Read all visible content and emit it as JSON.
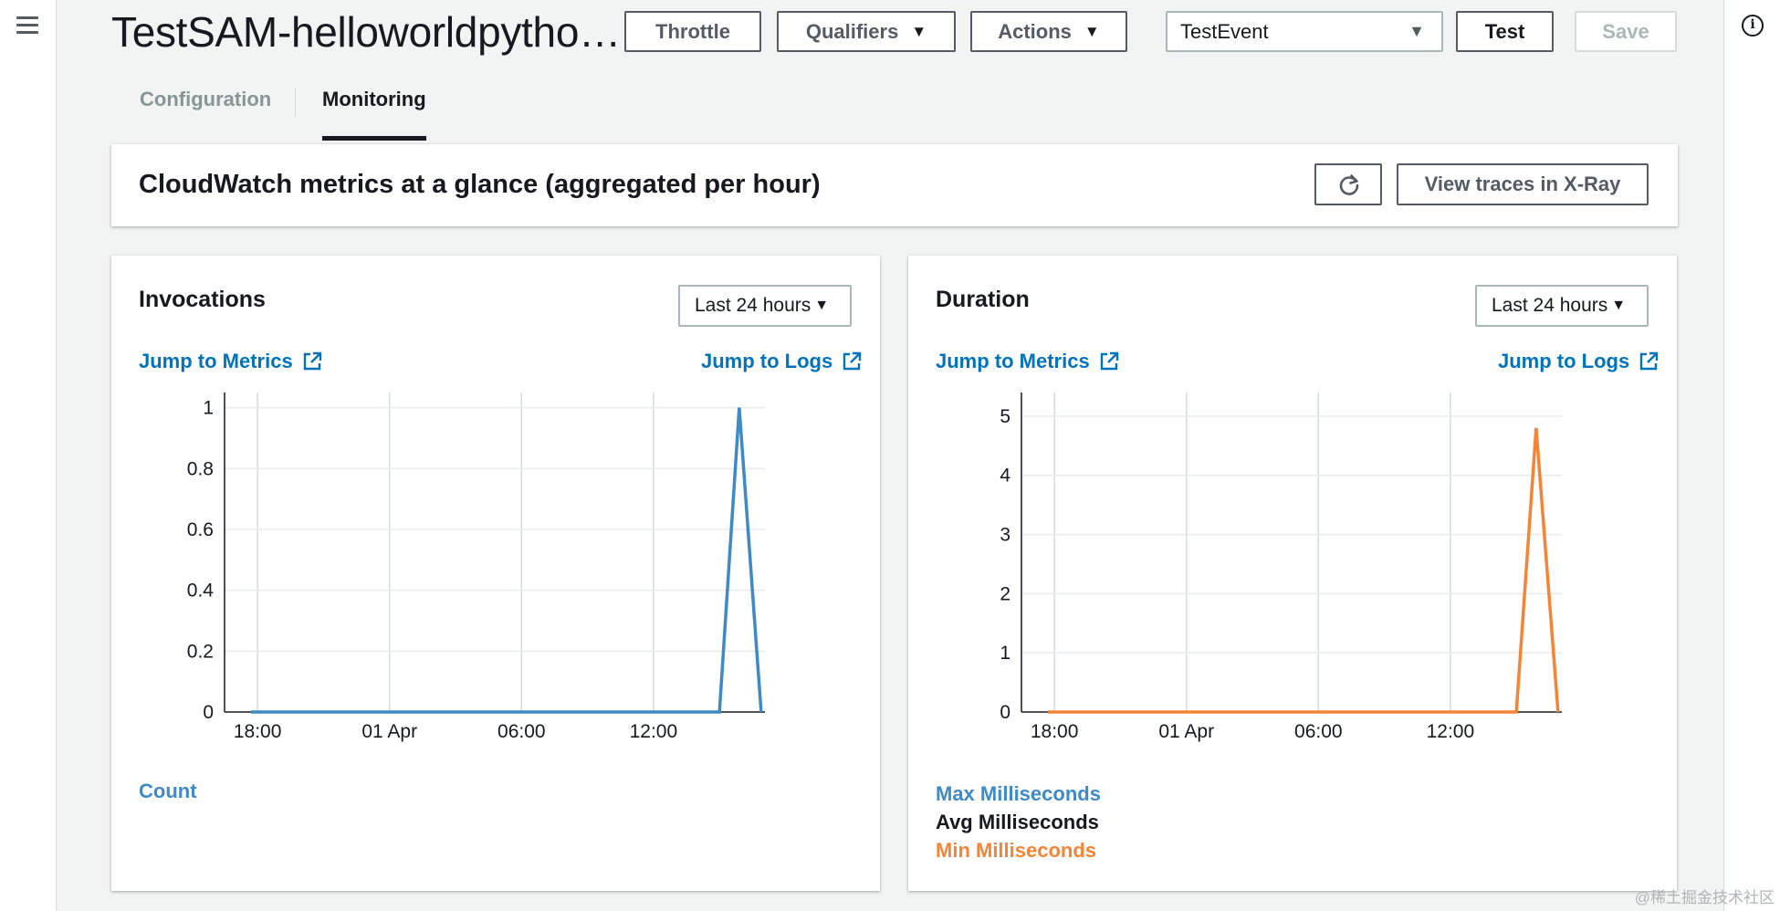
{
  "header": {
    "function_title": "TestSAM-helloworldpytho…",
    "throttle_label": "Throttle",
    "qualifiers_label": "Qualifiers",
    "actions_label": "Actions",
    "test_event_value": "TestEvent",
    "test_label": "Test",
    "save_label": "Save"
  },
  "tabs": [
    {
      "label": "Configuration",
      "active": false
    },
    {
      "label": "Monitoring",
      "active": true
    }
  ],
  "metrics_header": {
    "title": "CloudWatch metrics at a glance (aggregated per hour)",
    "xray_label": "View traces in X-Ray"
  },
  "invocations": {
    "title": "Invocations",
    "range": "Last 24 hours",
    "jump_metrics": "Jump to Metrics",
    "jump_logs": "Jump to Logs",
    "legend": [
      {
        "label": "Count",
        "color": "#3f8ac6"
      }
    ]
  },
  "duration": {
    "title": "Duration",
    "range": "Last 24 hours",
    "jump_metrics": "Jump to Metrics",
    "jump_logs": "Jump to Logs",
    "legend": [
      {
        "label": "Max Milliseconds",
        "color": "#3f8ac6"
      },
      {
        "label": "Avg Milliseconds",
        "color": "#16191f"
      },
      {
        "label": "Min Milliseconds",
        "color": "#f58536"
      }
    ]
  },
  "watermark": "@稀土掘金技术社区",
  "chart_data": [
    {
      "type": "line",
      "title": "Invocations",
      "x_ticks": [
        "18:00",
        "01 Apr",
        "06:00",
        "12:00"
      ],
      "y_ticks": [
        "0",
        "0.2",
        "0.4",
        "0.6",
        "0.8",
        "1"
      ],
      "ylim": [
        0,
        1.05
      ],
      "x": [
        -0.25,
        11.75,
        17.5,
        18.25,
        19.08
      ],
      "series": [
        {
          "name": "Count",
          "color": "#3f8ac6",
          "values": [
            0,
            0,
            0,
            1,
            0
          ]
        }
      ],
      "xlim": [
        -1.25,
        19.5
      ],
      "x_tick_positions": [
        0,
        5,
        10,
        15
      ],
      "grid": true
    },
    {
      "type": "line",
      "title": "Duration",
      "x_ticks": [
        "18:00",
        "01 Apr",
        "06:00",
        "12:00"
      ],
      "y_ticks": [
        "0",
        "1",
        "2",
        "3",
        "4",
        "5"
      ],
      "ylim": [
        0,
        5.4
      ],
      "x": [
        -0.25,
        11.75,
        17.5,
        18.25,
        19.08
      ],
      "series": [
        {
          "name": "Min Milliseconds",
          "color": "#f58536",
          "values": [
            0,
            0,
            0,
            4.8,
            0
          ]
        }
      ],
      "xlim": [
        -1.25,
        19.5
      ],
      "x_tick_positions": [
        0,
        5,
        10,
        15
      ],
      "grid": true
    }
  ]
}
